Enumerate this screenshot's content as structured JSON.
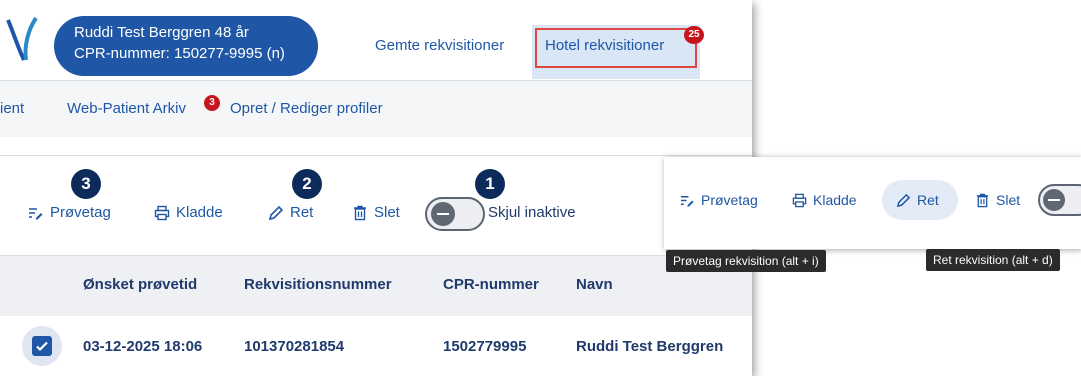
{
  "header": {
    "patient_name": "Ruddi Test Berggren 48 år",
    "patient_cpr": "CPR-nummer: 150277-9995 (n)",
    "saved_link": "Gemte rekvisitioner",
    "hotel_link": "Hotel rekvisitioner",
    "hotel_badge": "25"
  },
  "nav2": {
    "item_patient": "ient",
    "item_arkiv": "Web-Patient Arkiv",
    "arkiv_badge": "3",
    "item_profiler": "Opret / Rediger profiler"
  },
  "toolbar": {
    "proevetag": "Prøvetag",
    "kladde": "Kladde",
    "ret": "Ret",
    "slet": "Slet",
    "skjul_inaktive": "Skjul inaktive",
    "step_proevetag": "3",
    "step_ret": "2",
    "step_toggle": "1"
  },
  "table": {
    "columns": [
      "Ønsket prøvetid",
      "Rekvisitionsnummer",
      "CPR-nummer",
      "Navn"
    ],
    "rows": [
      [
        "03-12-2025 18:06",
        "101370281854",
        "1502779995",
        "Ruddi Test Berggren"
      ]
    ]
  },
  "inset": {
    "proevetag": "Prøvetag",
    "kladde": "Kladde",
    "ret": "Ret",
    "slet": "Slet",
    "tooltip_proevetag": "Prøvetag rekvisition (alt + i)",
    "tooltip_ret": "Ret rekvisition (alt + d)"
  },
  "colors": {
    "accent": "#1f57a6",
    "highlight_border": "#e04545",
    "badge": "#c8151d",
    "step_circle": "#0d2b5a"
  }
}
